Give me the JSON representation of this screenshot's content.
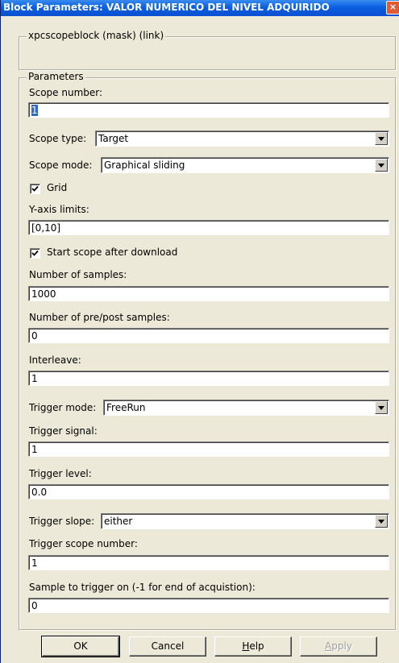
{
  "window": {
    "title": "Block Parameters: VALOR NUMERICO DEL NIVEL ADQUIRIDO",
    "close_glyph": "×"
  },
  "description_group": {
    "legend": "xpcscopeblock (mask) (link)"
  },
  "parameters": {
    "legend": "Parameters",
    "scope_number": {
      "label": "Scope number:",
      "value": "1"
    },
    "scope_type": {
      "label": "Scope type:",
      "value": "Target"
    },
    "scope_mode": {
      "label": "Scope mode:",
      "value": "Graphical sliding"
    },
    "grid": {
      "label": "Grid",
      "checked": true
    },
    "y_axis_limits": {
      "label": "Y-axis limits:",
      "value": "[0,10]"
    },
    "start_scope": {
      "label": "Start scope after download",
      "checked": true
    },
    "num_samples": {
      "label": "Number of samples:",
      "value": "1000"
    },
    "num_prepost": {
      "label": "Number of pre/post samples:",
      "value": "0"
    },
    "interleave": {
      "label": "Interleave:",
      "value": "1"
    },
    "trigger_mode": {
      "label": "Trigger mode:",
      "value": "FreeRun"
    },
    "trigger_signal": {
      "label": "Trigger signal:",
      "value": "1"
    },
    "trigger_level": {
      "label": "Trigger level:",
      "value": "0.0"
    },
    "trigger_slope": {
      "label": "Trigger slope:",
      "value": "either"
    },
    "trigger_scope_number": {
      "label": "Trigger scope number:",
      "value": "1"
    },
    "sample_to_trigger": {
      "label": "Sample to trigger on (-1 for end of acquistion):",
      "value": "0"
    }
  },
  "buttons": {
    "ok": "OK",
    "cancel": "Cancel",
    "help_h": "H",
    "help_rest": "elp",
    "apply_a": "A",
    "apply_rest": "pply"
  },
  "colors": {
    "title_bar": "#0a5fe0",
    "dialog_bg": "#ece9d8",
    "selection": "#316ac5"
  }
}
